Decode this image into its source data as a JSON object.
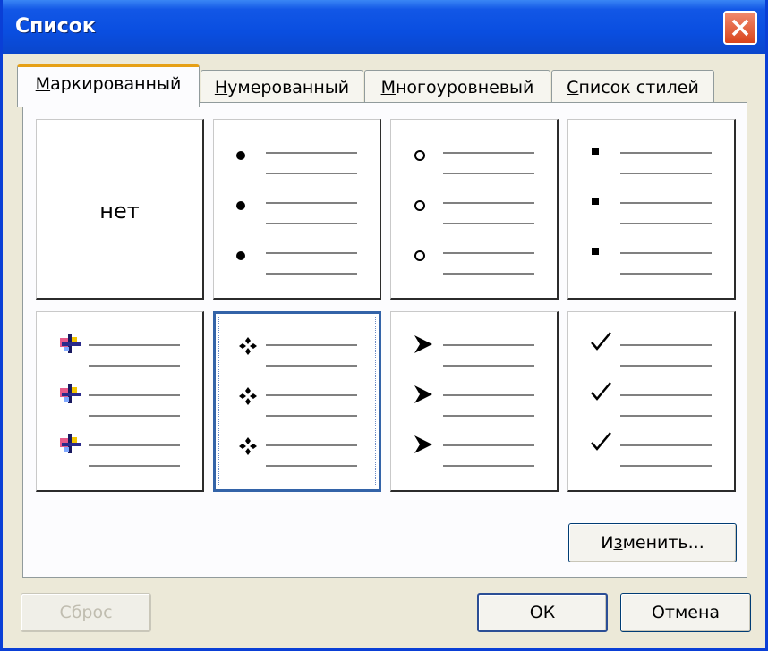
{
  "window": {
    "title": "Список"
  },
  "tabs": [
    {
      "label_pre": "",
      "label_ul": "М",
      "label_post": "аркированный",
      "active": true
    },
    {
      "label_pre": "",
      "label_ul": "Н",
      "label_post": "умерованный",
      "active": false
    },
    {
      "label_pre": "",
      "label_ul": "М",
      "label_post": "ногоуровневый",
      "active": false
    },
    {
      "label_pre": "",
      "label_ul": "С",
      "label_post": "писок стилей",
      "active": false
    }
  ],
  "bullet_styles": [
    {
      "bullet": "none",
      "label": "нет"
    },
    {
      "bullet": "filled-dot-icon"
    },
    {
      "bullet": "hollow-circle-icon"
    },
    {
      "bullet": "filled-square-icon"
    },
    {
      "bullet": "colorful-cross-icon"
    },
    {
      "bullet": "four-diamond-icon",
      "selected": true
    },
    {
      "bullet": "arrowhead-icon"
    },
    {
      "bullet": "checkmark-icon"
    }
  ],
  "buttons": {
    "modify_pre": "И",
    "modify_ul": "з",
    "modify_post": "менить...",
    "reset": "Сброс",
    "ok": "ОК",
    "cancel": "Отмена"
  },
  "colors": {
    "title_bar": "#0a4ee0",
    "close_button": "#d9441c",
    "tab_highlight": "#e6a016",
    "selection": "#3363a8"
  }
}
